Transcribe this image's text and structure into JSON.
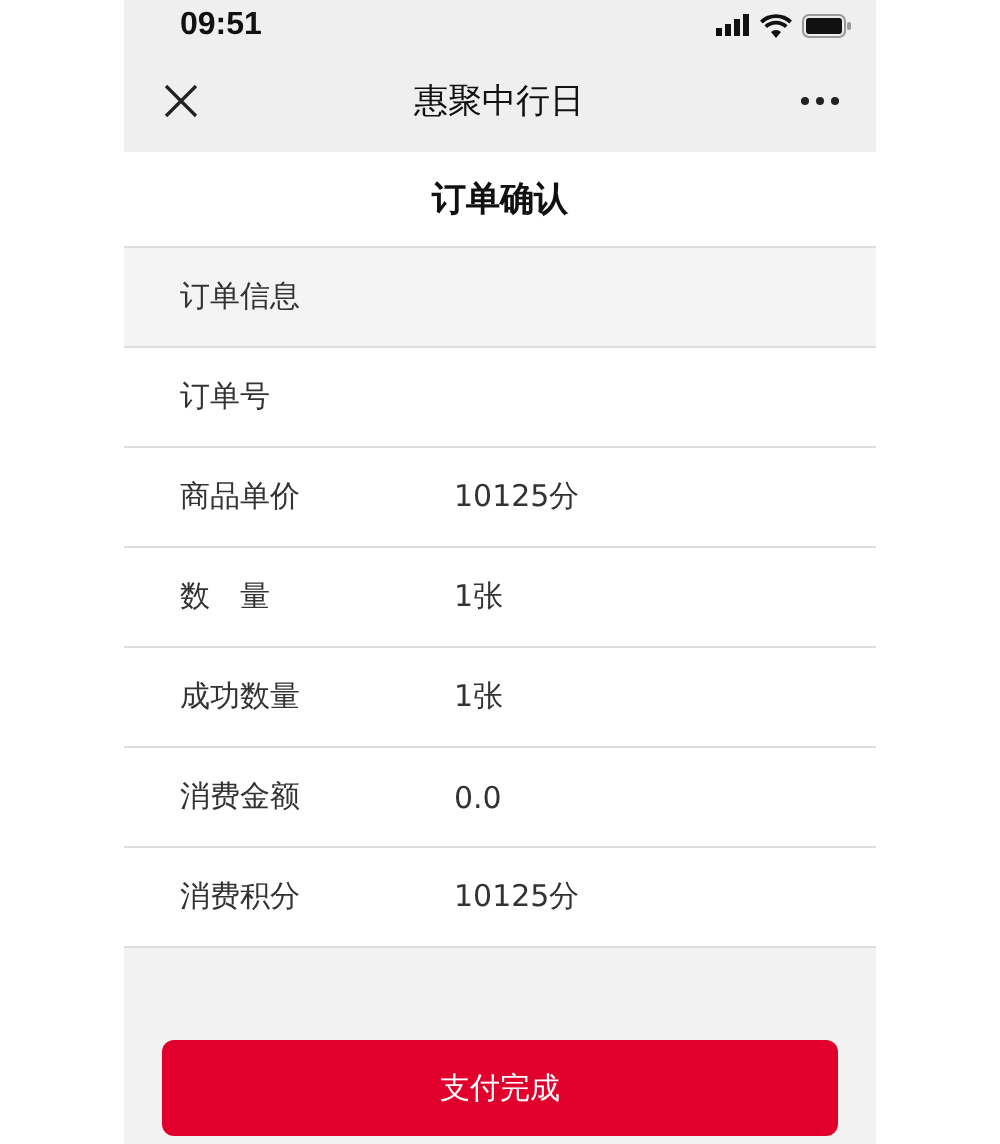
{
  "status_bar": {
    "time": "09:51"
  },
  "nav_bar": {
    "title": "惠聚中行日"
  },
  "page_title": "订单确认",
  "rows": [
    {
      "kind": "section",
      "label": "订单信息"
    },
    {
      "kind": "field",
      "label": "订单号"
    },
    {
      "kind": "field",
      "label": "商品单价",
      "value": "10125分"
    },
    {
      "kind": "field",
      "label": "数　量",
      "value": "1张"
    },
    {
      "kind": "field",
      "label": "成功数量",
      "value": "1张"
    },
    {
      "kind": "field",
      "label": "消费金额",
      "value": "0.0"
    },
    {
      "kind": "field",
      "label": "消费积分",
      "value": "10125分"
    }
  ],
  "button": "支付完成"
}
